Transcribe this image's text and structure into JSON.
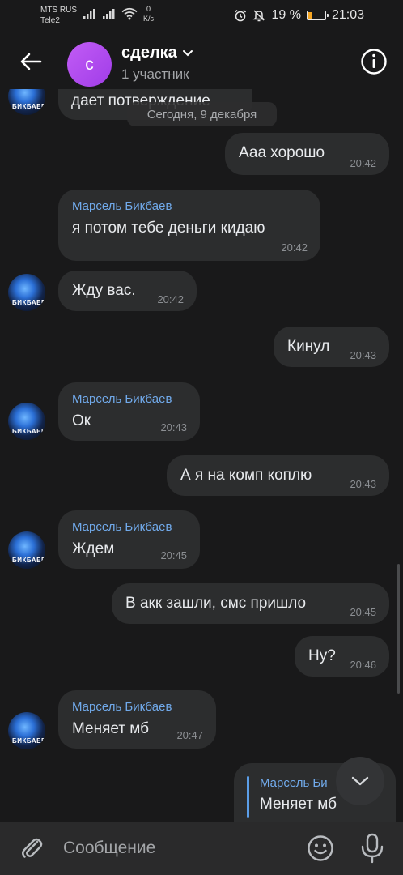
{
  "status_bar": {
    "carrier1": "MTS RUS",
    "carrier2": "Tele2",
    "net_speed_value": "0",
    "net_speed_unit": "K/s",
    "battery": "19 %",
    "time": "21:03"
  },
  "header": {
    "avatar_letter": "с",
    "title": "сделка",
    "subtitle": "1 участник",
    "avatar_color": "#b44cf0"
  },
  "date_separator": "Сегодня, 9 декабря",
  "avatar_caption": "БИКБАЕВ",
  "messages": [
    {
      "text": "дает потверждение"
    },
    {
      "text": "Ааа хорошо",
      "time": "20:42"
    },
    {
      "sender": "Марсель Бикбаев",
      "text": "я потом тебе деньги кидаю",
      "time": "20:42"
    },
    {
      "text": "Жду вас.",
      "time": "20:42"
    },
    {
      "text": "Кинул",
      "time": "20:43"
    },
    {
      "sender": "Марсель Бикбаев",
      "text": "Ок",
      "time": "20:43"
    },
    {
      "text": "А я на комп коплю",
      "time": "20:43"
    },
    {
      "sender": "Марсель Бикбаев",
      "text": "Ждем",
      "time": "20:45"
    },
    {
      "text": "В акк зашли, смс пришло",
      "time": "20:45"
    },
    {
      "text": "Ну?",
      "time": "20:46"
    },
    {
      "sender": "Марсель Бикбаев",
      "text": "Меняет мб",
      "time": "20:47"
    },
    {
      "reply_sender": "Марсель Би",
      "reply_text": "Меняет мб"
    }
  ],
  "composer": {
    "placeholder": "Сообщение"
  },
  "colors": {
    "background": "#19191a",
    "bubble": "#2c2d2e",
    "sender_name": "#71aaeb",
    "accent": "#5b9ee8"
  }
}
